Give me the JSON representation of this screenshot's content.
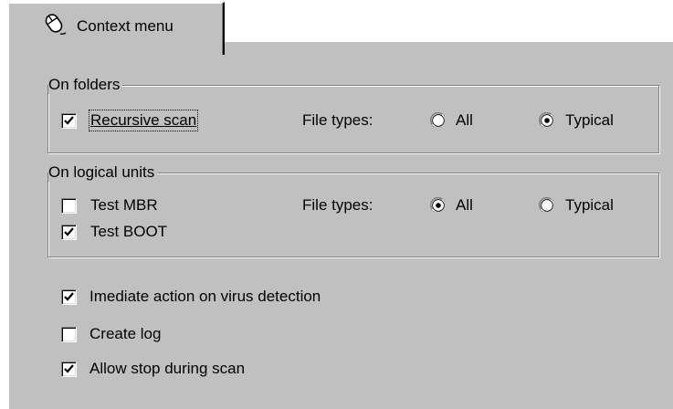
{
  "tab": {
    "label": "Context menu",
    "icon": "mouse-icon"
  },
  "folders": {
    "legend": "On folders",
    "recursive_scan": {
      "label": "Recursive scan",
      "checked": true
    },
    "file_types_label": "File types:",
    "option_all": {
      "label": "All",
      "selected": false
    },
    "option_typical": {
      "label": "Typical",
      "selected": true
    }
  },
  "logical": {
    "legend": "On logical units",
    "test_mbr": {
      "label": "Test MBR",
      "checked": false
    },
    "test_boot": {
      "label": "Test BOOT",
      "checked": true
    },
    "file_types_label": "File types:",
    "option_all": {
      "label": "All",
      "selected": true
    },
    "option_typical": {
      "label": "Typical",
      "selected": false
    }
  },
  "options": {
    "immediate_action": {
      "label": "Imediate action on virus detection",
      "checked": true
    },
    "create_log": {
      "label": "Create log",
      "checked": false
    },
    "allow_stop": {
      "label": "Allow stop during scan",
      "checked": true
    }
  }
}
